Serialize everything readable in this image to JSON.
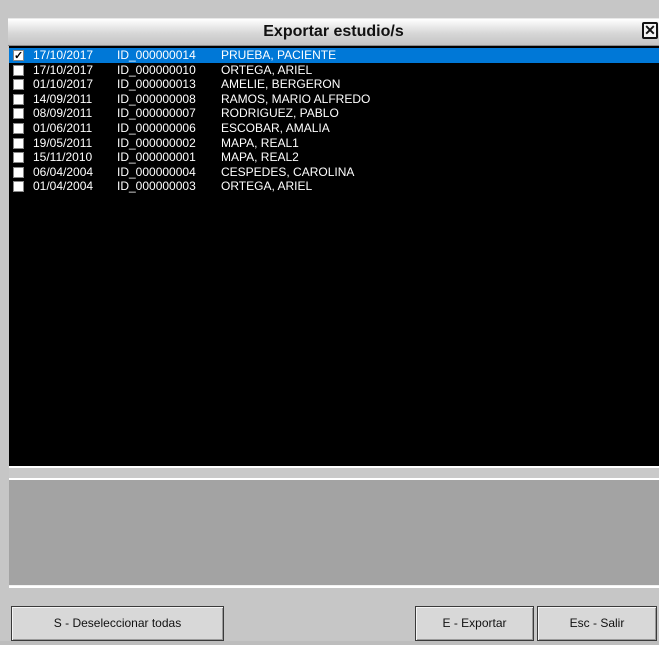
{
  "window": {
    "title": "Exportar estudio/s",
    "close_glyph": "✕"
  },
  "studies": [
    {
      "checked": true,
      "date": "17/10/2017",
      "id": "ID_000000014",
      "name": "PRUEBA, PACIENTE"
    },
    {
      "checked": false,
      "date": "17/10/2017",
      "id": "ID_000000010",
      "name": "ORTEGA, ARIEL"
    },
    {
      "checked": false,
      "date": "01/10/2017",
      "id": "ID_000000013",
      "name": "AMELIE, BERGERON"
    },
    {
      "checked": false,
      "date": "14/09/2011",
      "id": "ID_000000008",
      "name": "RAMOS, MARIO ALFREDO"
    },
    {
      "checked": false,
      "date": "08/09/2011",
      "id": "ID_000000007",
      "name": "RODRIGUEZ, PABLO"
    },
    {
      "checked": false,
      "date": "01/06/2011",
      "id": "ID_000000006",
      "name": "ESCOBAR, AMALIA"
    },
    {
      "checked": false,
      "date": "19/05/2011",
      "id": "ID_000000002",
      "name": "MAPA, REAL1"
    },
    {
      "checked": false,
      "date": "15/11/2010",
      "id": "ID_000000001",
      "name": "MAPA, REAL2"
    },
    {
      "checked": false,
      "date": "06/04/2004",
      "id": "ID_000000004",
      "name": "CESPEDES, CAROLINA"
    },
    {
      "checked": false,
      "date": "01/04/2004",
      "id": "ID_000000003",
      "name": "ORTEGA, ARIEL"
    }
  ],
  "buttons": {
    "deselect_all": "S - Deseleccionar todas",
    "export": "E - Exportar",
    "exit": "Esc - Salir"
  },
  "colors": {
    "list_bg": "#000000",
    "selection": "#0078d7",
    "panel": "#a3a3a3",
    "chrome": "#c6c6c6"
  }
}
